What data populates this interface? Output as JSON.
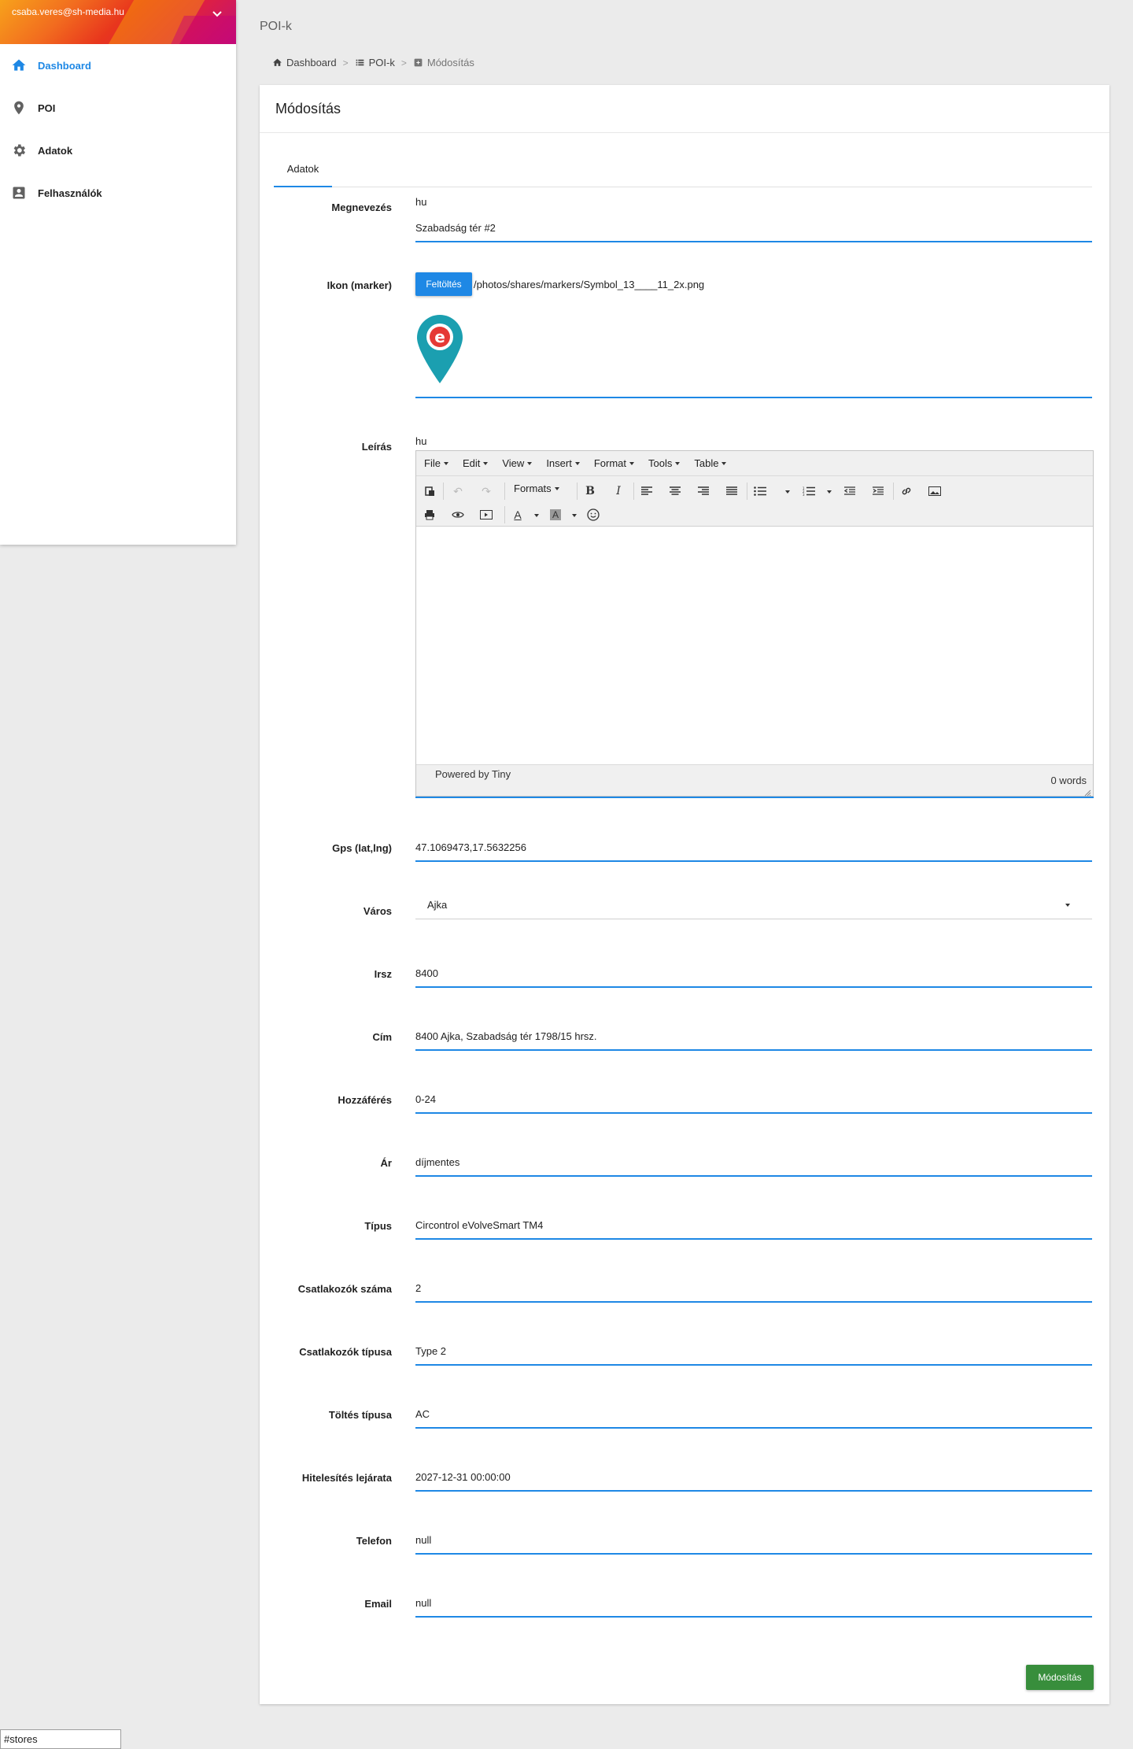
{
  "sidebar": {
    "user_email": "csaba.veres@sh-media.hu",
    "items": [
      {
        "label": "Dashboard",
        "icon": "home-icon",
        "active": true
      },
      {
        "label": "POI",
        "icon": "map-pin-icon",
        "active": false
      },
      {
        "label": "Adatok",
        "icon": "gear-icon",
        "active": false
      },
      {
        "label": "Felhasználók",
        "icon": "account-box-icon",
        "active": false
      }
    ]
  },
  "page": {
    "header": "POI-k",
    "breadcrumb": [
      "Dashboard",
      "POI-k",
      "Módosítás"
    ]
  },
  "card": {
    "title": "Módosítás",
    "tab": "Adatok",
    "submit_label": "Módosítás"
  },
  "form": {
    "name": {
      "label": "Megnevezés",
      "lang": "hu",
      "value": "Szabadság tér #2"
    },
    "icon": {
      "label": "Ikon (marker)",
      "upload_label": "Feltöltés",
      "path": "/photos/shares/markers/Symbol_13____11_2x.png",
      "marker_color": "#1b9fb0",
      "marker_letter": "e"
    },
    "description": {
      "label": "Leírás",
      "lang": "hu"
    },
    "gps": {
      "label": "Gps (lat,lng)",
      "value": "47.1069473,17.5632256"
    },
    "city": {
      "label": "Város",
      "value": "Ajka"
    },
    "zip": {
      "label": "Irsz",
      "value": "8400"
    },
    "address": {
      "label": "Cím",
      "value": "8400 Ajka, Szabadság tér 1798/15 hrsz."
    },
    "access": {
      "label": "Hozzáférés",
      "value": "0-24"
    },
    "price": {
      "label": "Ár",
      "value": "díjmentes"
    },
    "type": {
      "label": "Típus",
      "value": "Circontrol eVolveSmart TM4"
    },
    "connector_count": {
      "label": "Csatlakozók száma",
      "value": "2"
    },
    "connector_type": {
      "label": "Csatlakozók típusa",
      "value": "Type 2"
    },
    "charge_type": {
      "label": "Töltés típusa",
      "value": "AC"
    },
    "cert_expiry": {
      "label": "Hitelesítés lejárata",
      "value": "2027-12-31 00:00:00"
    },
    "phone": {
      "label": "Telefon",
      "value": "null"
    },
    "email": {
      "label": "Email",
      "value": "null"
    }
  },
  "editor": {
    "menu": [
      "File",
      "Edit",
      "View",
      "Insert",
      "Format",
      "Tools",
      "Table"
    ],
    "formats_label": "Formats",
    "powered_by": "Powered by Tiny",
    "word_count": "0 words"
  },
  "status_bar": {
    "url": "#stores"
  },
  "colors": {
    "accent": "#1e88e5",
    "submit": "#388e3c",
    "active_nav": "#1e88e5"
  }
}
